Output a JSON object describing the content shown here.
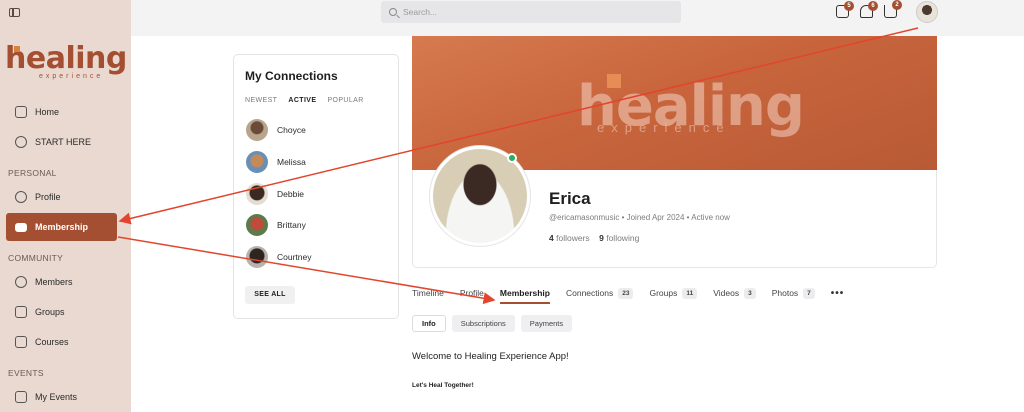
{
  "sidebar": {
    "logo_text": "healing",
    "logo_sub": "experience",
    "items": [
      {
        "label": "Home"
      },
      {
        "label": "START HERE"
      }
    ],
    "sections": [
      {
        "title": "PERSONAL",
        "items": [
          {
            "label": "Profile"
          },
          {
            "label": "Membership"
          }
        ]
      },
      {
        "title": "COMMUNITY",
        "items": [
          {
            "label": "Members"
          },
          {
            "label": "Groups"
          },
          {
            "label": "Courses"
          }
        ]
      },
      {
        "title": "EVENTS",
        "items": [
          {
            "label": "My Events"
          }
        ]
      }
    ],
    "active_item": "Membership",
    "accent": "#a44f32"
  },
  "topbar": {
    "search_placeholder": "Search...",
    "badges": {
      "messages": "5",
      "notifications": "6",
      "cart": "2"
    }
  },
  "connections": {
    "title": "My Connections",
    "tabs": [
      "NEWEST",
      "ACTIVE",
      "POPULAR"
    ],
    "active_tab": "ACTIVE",
    "people": [
      "Choyce",
      "Melissa",
      "Debbie",
      "Brittany",
      "Courtney"
    ],
    "see_all": "SEE ALL"
  },
  "cover": {
    "logo_text": "healing",
    "logo_sub": "experience"
  },
  "profile": {
    "name": "Erica",
    "meta": "@ericamasonmusic • Joined Apr 2024 • Active now",
    "followers_count": "4",
    "followers_label": "followers",
    "following_count": "9",
    "following_label": "following"
  },
  "tabs": [
    {
      "label": "Timeline",
      "count": null
    },
    {
      "label": "Profile",
      "count": null
    },
    {
      "label": "Membership",
      "count": null
    },
    {
      "label": "Connections",
      "count": "23"
    },
    {
      "label": "Groups",
      "count": "11"
    },
    {
      "label": "Videos",
      "count": "3"
    },
    {
      "label": "Photos",
      "count": "7"
    }
  ],
  "active_tab": "Membership",
  "subtabs": [
    "Info",
    "Subscriptions",
    "Payments"
  ],
  "active_subtab": "Info",
  "content": {
    "welcome": "Welcome to Healing Experience App!",
    "tagline": "Let's Heal Together!"
  },
  "annotation_color": "#e2452c"
}
